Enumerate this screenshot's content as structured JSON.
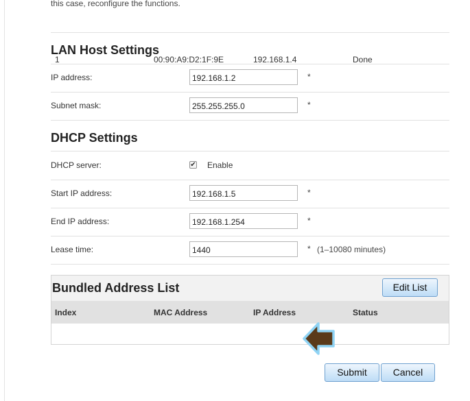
{
  "intro_text": "this case, reconfigure the functions.",
  "lan": {
    "title": "LAN Host Settings",
    "ip_label": "IP address:",
    "ip_value": "192.168.1.2",
    "mask_label": "Subnet mask:",
    "mask_value": "255.255.255.0",
    "required_mark": "*"
  },
  "dhcp": {
    "title": "DHCP Settings",
    "server_label": "DHCP server:",
    "enable_label": "Enable",
    "enabled": true,
    "start_label": "Start IP address:",
    "start_value": "192.168.1.5",
    "end_label": "End IP address:",
    "end_value": "192.168.1.254",
    "lease_label": "Lease time:",
    "lease_value": "1440",
    "lease_hint": "(1–10080 minutes)",
    "required_mark": "*"
  },
  "bundled": {
    "title": "Bundled Address List",
    "edit_button": "Edit List",
    "columns": [
      "Index",
      "MAC Address",
      "IP Address",
      "Status"
    ],
    "rows": [
      {
        "index": "1",
        "mac": "00:90:A9:D2:1F:9E",
        "ip": "192.168.1.4",
        "status": "Done"
      }
    ]
  },
  "actions": {
    "submit": "Submit",
    "cancel": "Cancel"
  },
  "colors": {
    "annotation_arrow_fill": "#5a3a1a",
    "annotation_arrow_outline": "#8fd3f4",
    "button_border": "#6ea0cf"
  },
  "icons": {
    "checkbox": "check-mark",
    "annotation": "left-pointing-arrow"
  }
}
